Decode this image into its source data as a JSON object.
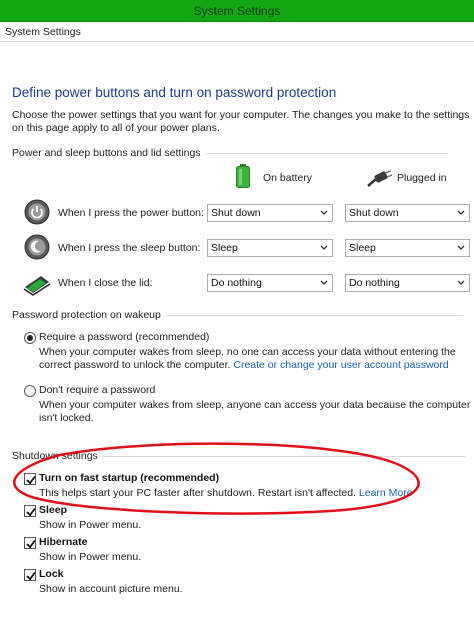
{
  "window": {
    "title": "System Settings"
  },
  "address": {
    "text": "System Settings"
  },
  "page": {
    "heading": "Define power buttons and turn on password protection",
    "intro": "Choose the power settings that you want for your computer. The changes you make to the settings on this page apply to all of your power plans."
  },
  "power_section": {
    "title": "Power and sleep buttons and lid settings",
    "col_battery": "On battery",
    "col_plugged": "Plugged in",
    "rows": [
      {
        "label": "When I press the power button:",
        "battery": "Shut down",
        "plugged": "Shut down"
      },
      {
        "label": "When I press the sleep button:",
        "battery": "Sleep",
        "plugged": "Sleep"
      },
      {
        "label": "When I close the lid:",
        "battery": "Do nothing",
        "plugged": "Do nothing"
      }
    ]
  },
  "password_section": {
    "title": "Password protection on wakeup",
    "require_label": "Require a password (recommended)",
    "require_desc": "When your computer wakes from sleep, no one can access your data without entering the correct password to unlock the computer.",
    "require_link": "Create or change your user account password",
    "norequire_label": "Don't require a password",
    "norequire_desc": "When your computer wakes from sleep, anyone can access your data because the computer isn't locked."
  },
  "shutdown_section": {
    "title": "Shutdown settings",
    "items": [
      {
        "label": "Turn on fast startup (recommended)",
        "desc": "This helps start your PC faster after shutdown. Restart isn't affected.",
        "link": "Learn More",
        "checked": true
      },
      {
        "label": "Sleep",
        "desc": "Show in Power menu.",
        "checked": true
      },
      {
        "label": "Hibernate",
        "desc": "Show in Power menu.",
        "checked": true
      },
      {
        "label": "Lock",
        "desc": "Show in account picture menu.",
        "checked": true
      }
    ]
  },
  "colors": {
    "titlebar": "#12a612",
    "heading": "#1e3a8a",
    "link": "#1a5fb4",
    "annotation": "#e0101a"
  },
  "icons": [
    "battery-icon",
    "plug-icon",
    "power-button-icon",
    "sleep-button-icon",
    "laptop-lid-icon",
    "dropdown-arrow-icon",
    "checkmark-icon"
  ]
}
